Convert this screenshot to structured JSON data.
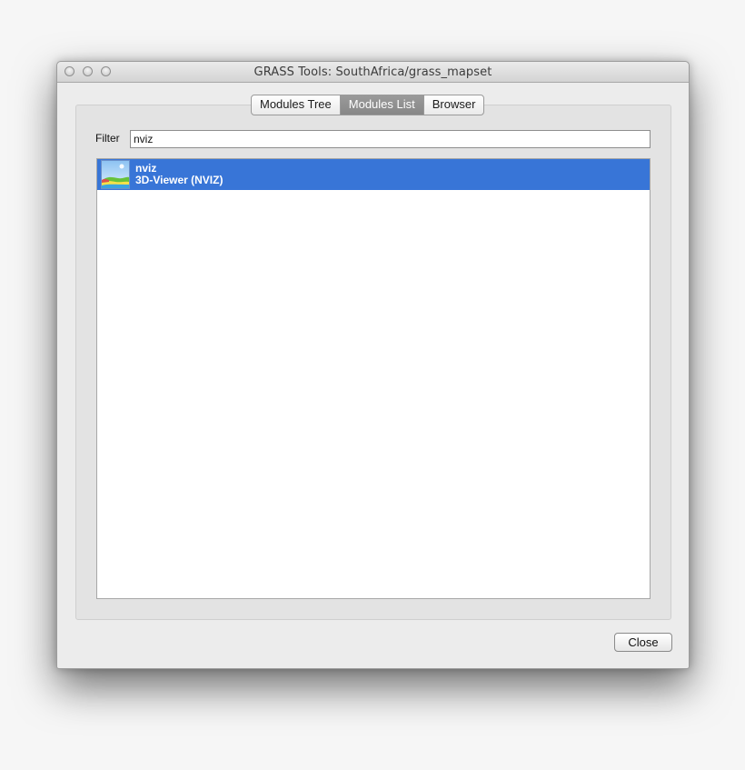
{
  "window": {
    "title": "GRASS Tools: SouthAfrica/grass_mapset"
  },
  "tabs": [
    {
      "label": "Modules Tree",
      "active": false
    },
    {
      "label": "Modules List",
      "active": true
    },
    {
      "label": "Browser",
      "active": false
    }
  ],
  "filter": {
    "label": "Filter",
    "value": "nviz"
  },
  "modules": [
    {
      "name": "nviz",
      "description": "3D-Viewer (NVIZ)",
      "icon": "nviz-3d-terrain-icon",
      "selected": true
    }
  ],
  "footer": {
    "close_label": "Close"
  },
  "colors": {
    "selection": "#3875d7",
    "active_tab": "#8e8e8e"
  }
}
